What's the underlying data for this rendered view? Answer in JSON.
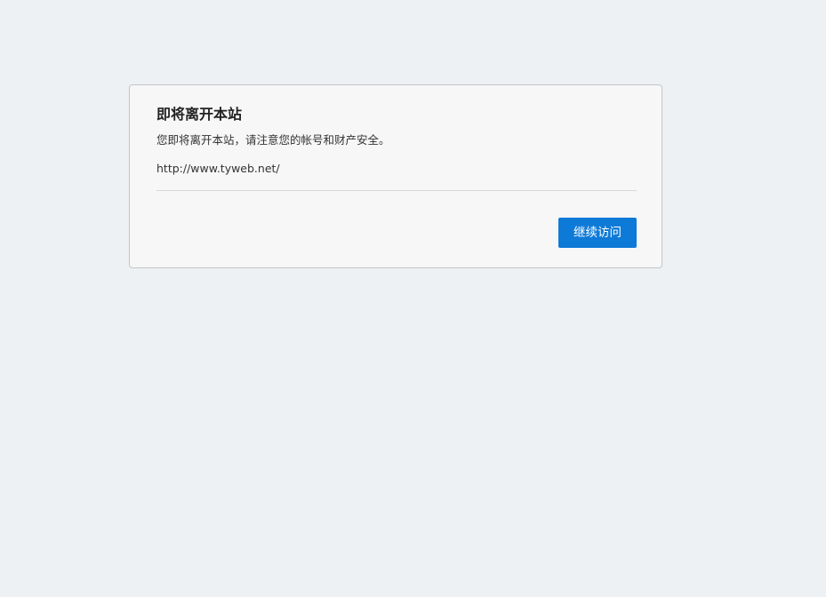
{
  "dialog": {
    "title": "即将离开本站",
    "message": "您即将离开本站，请注意您的帐号和财产安全。",
    "url": "http://www.tyweb.net/",
    "continue_label": "继续访问"
  },
  "colors": {
    "page_background": "#edf1f4",
    "card_background": "#f7f7f7",
    "button_background": "#0e7ad7"
  }
}
